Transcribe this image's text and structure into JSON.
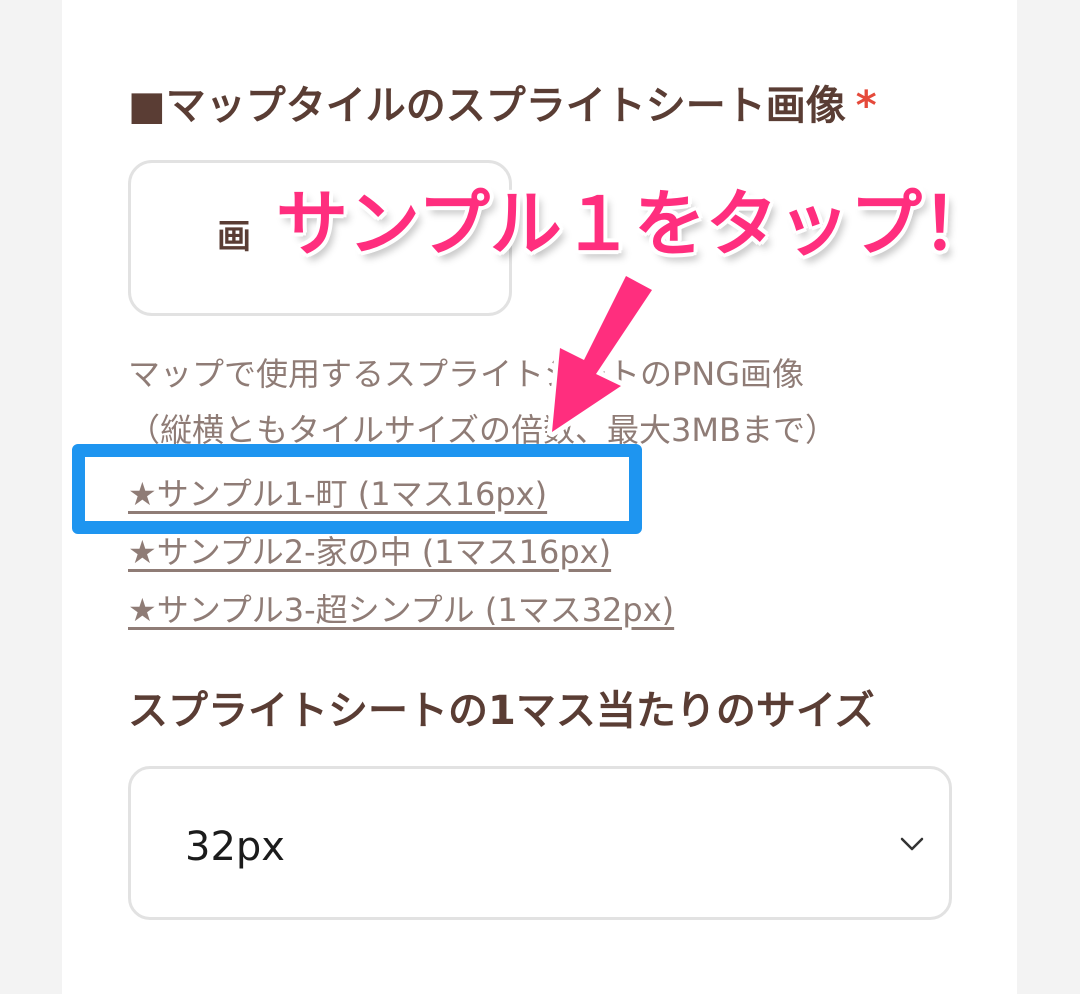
{
  "sprite_section": {
    "title": "■マップタイルのスプライトシート画像",
    "required_mark": "*",
    "upload_button_label": "画",
    "help_lines": [
      "マップで使用するスプライトシートのPNG画像",
      "（縦横ともタイルサイズの倍数、最大3MBまで）"
    ],
    "samples": [
      "★サンプル1-町 (1マス16px)",
      "★サンプル2-家の中 (1マス16px)",
      "★サンプル3-超シンプル (1マス32px)"
    ]
  },
  "annotation": {
    "text": "サンプル１をタップ！",
    "color": "#ff2e7e",
    "highlight_color": "#1e95f0"
  },
  "tile_size_section": {
    "title": "スプライトシートの1マス当たりのサイズ",
    "selected_value": "32px",
    "icon": "chevron-down-icon"
  },
  "colors": {
    "heading": "#5a3d34",
    "help_text": "#8f7c76",
    "required": "#e5493a",
    "page_background": "#f3f3f3"
  }
}
